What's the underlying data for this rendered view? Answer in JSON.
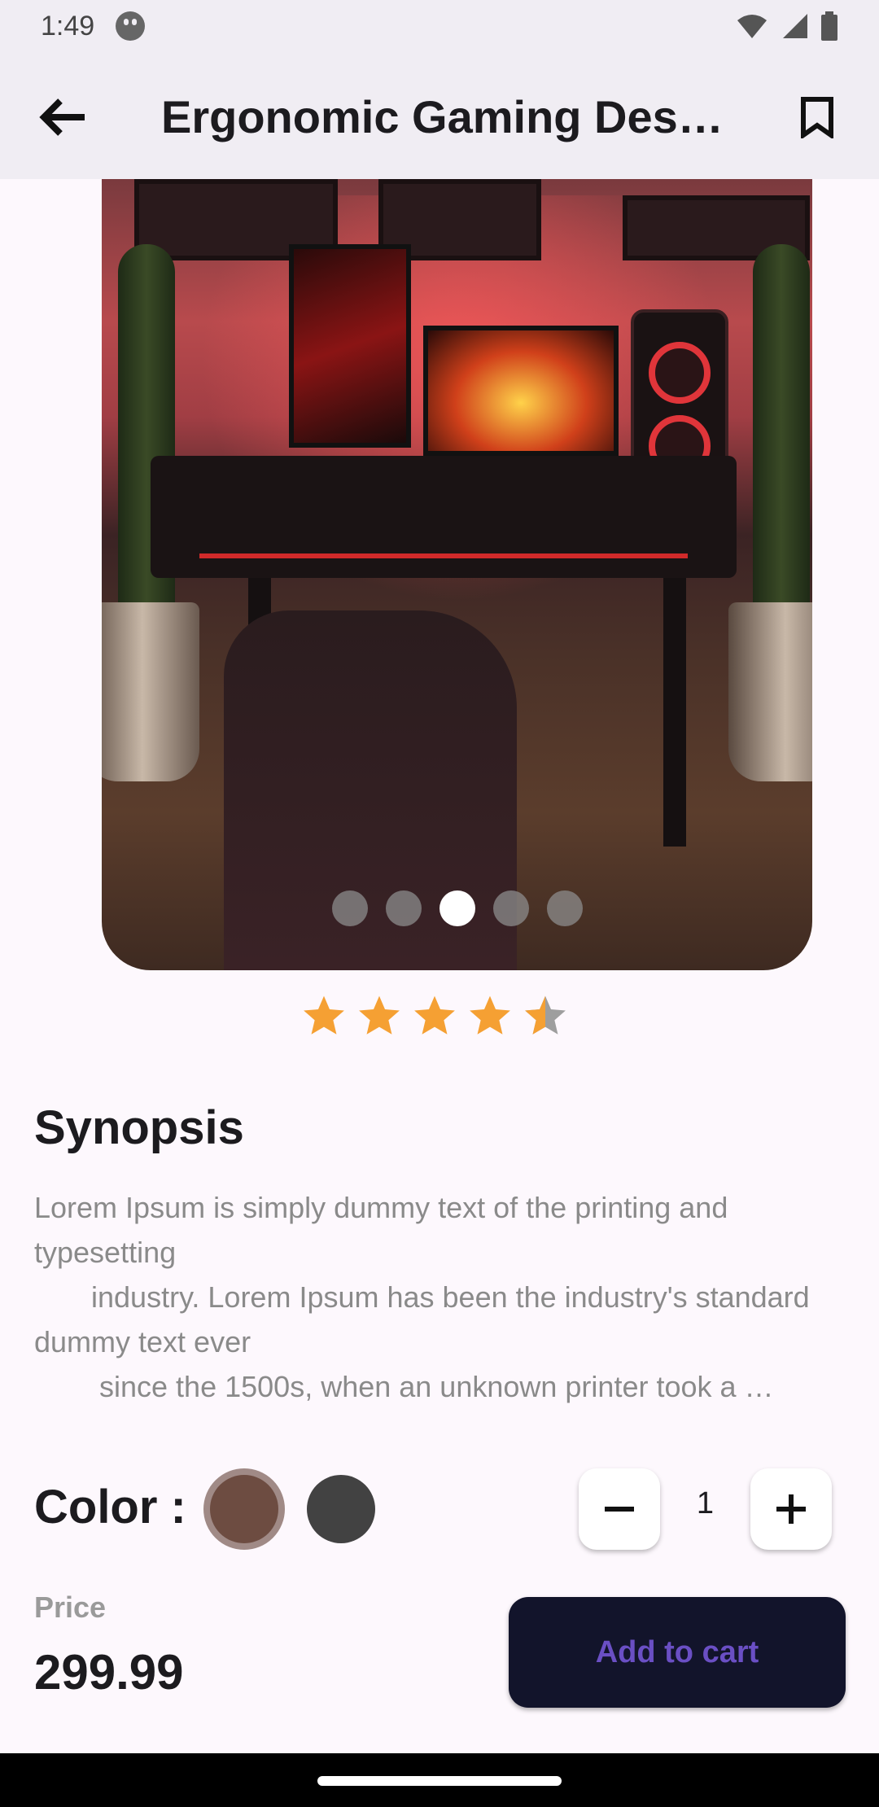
{
  "status_bar": {
    "time": "1:49",
    "icons": [
      "cat-icon",
      "wifi-icon",
      "signal-icon",
      "battery-icon"
    ]
  },
  "app_bar": {
    "title": "Ergonomic Gaming Des…",
    "back_icon": "arrow-back-icon",
    "bookmark_icon": "bookmark-icon"
  },
  "gallery": {
    "image_description_icon": "product-photo",
    "page_count": 5,
    "active_index": 2
  },
  "rating": {
    "value": 4.5,
    "max": 5,
    "star_color": "#f5a033",
    "empty_color": "#9e9e9e"
  },
  "synopsis": {
    "title": "Synopsis",
    "text": "Lorem Ipsum is simply dummy text of the printing and typesetting\n       industry. Lorem Ipsum has been the industry's standard dummy text ever\n        since the 1500s, when an unknown printer took a …"
  },
  "color": {
    "label": "Color :",
    "options": [
      {
        "name": "brown",
        "hex": "#6d4c41",
        "selected": true
      },
      {
        "name": "dark-grey",
        "hex": "#424242",
        "selected": false
      }
    ]
  },
  "quantity": {
    "value": "1",
    "minus_icon": "minus-icon",
    "plus_icon": "plus-icon"
  },
  "price": {
    "label": "Price",
    "value": "299.99"
  },
  "cart": {
    "label": "Add to cart",
    "bg_color": "#12142b",
    "text_color": "#6a4fc4"
  }
}
